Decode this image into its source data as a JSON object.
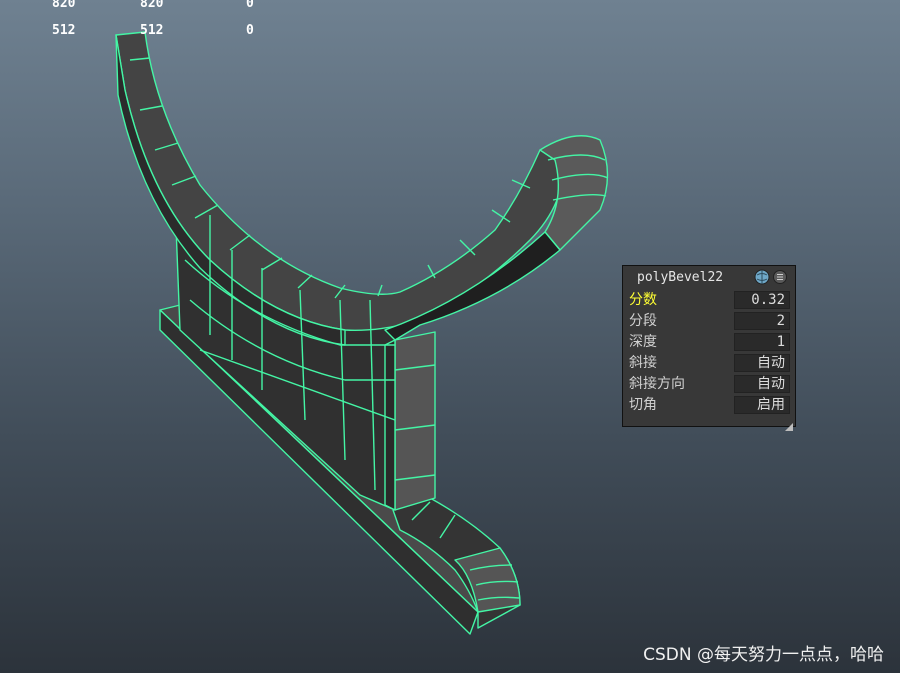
{
  "hud": {
    "rows": [
      [
        "820",
        "820",
        "0"
      ],
      [
        "512",
        "512",
        "0"
      ]
    ]
  },
  "bevel_panel": {
    "title": "polyBevel22",
    "attributes": [
      {
        "label": "分数",
        "value": "0.32",
        "highlighted": true
      },
      {
        "label": "分段",
        "value": "2",
        "highlighted": false
      },
      {
        "label": "深度",
        "value": "1",
        "highlighted": false
      },
      {
        "label": "斜接",
        "value": "自动",
        "highlighted": false
      },
      {
        "label": "斜接方向",
        "value": "自动",
        "highlighted": false
      },
      {
        "label": "切角",
        "value": "启用",
        "highlighted": false
      }
    ],
    "icons": [
      "globe-icon",
      "menu-icon"
    ]
  },
  "watermark": "CSDN @每天努力一点点，哈哈",
  "colors": {
    "wireframe": "#3dfaa0",
    "mesh_face": "#3a3a3a",
    "highlight_label": "#ffff33"
  }
}
